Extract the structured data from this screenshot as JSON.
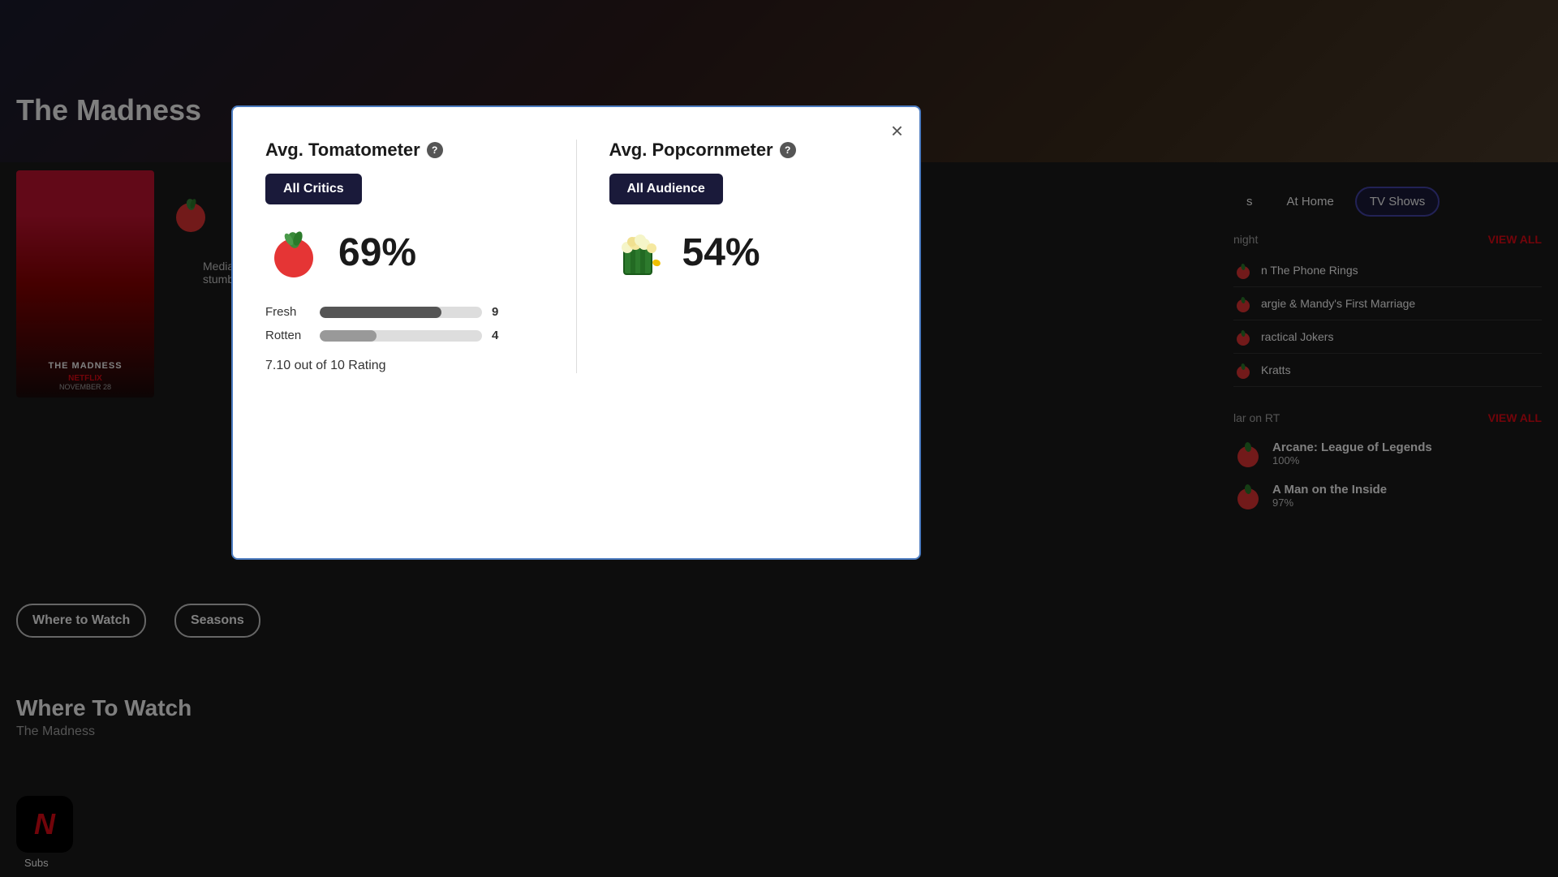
{
  "page": {
    "title": "The Madness"
  },
  "background": {
    "hero_gradient": "dark thriller background"
  },
  "left_panel": {
    "page_title": "The Madness",
    "poster": {
      "title_text": "THE MADNESS",
      "platform": "NETFLIX",
      "release": "NOVEMBER 28"
    },
    "description": "Media... stumb...",
    "where_to_watch_btn": "Where to Watch",
    "seasons_btn": "Seasons",
    "where_to_watch_section": {
      "title": "Where To Watch",
      "subtitle": "The Madness"
    },
    "netflix_app": {
      "label": "Subs"
    }
  },
  "right_panel": {
    "nav_tabs": [
      {
        "label": "s",
        "active": false
      },
      {
        "label": "At Home",
        "active": false
      },
      {
        "label": "TV Shows",
        "active": true
      }
    ],
    "tonight_section": {
      "label": "night",
      "view_all": "VIEW ALL",
      "shows": [
        {
          "title": "n The Phone Rings",
          "score": ""
        },
        {
          "title": "argie & Mandy's First Marriage",
          "score": ""
        },
        {
          "title": "ractical Jokers",
          "score": ""
        },
        {
          "title": "Kratts",
          "score": ""
        }
      ]
    },
    "popular_section": {
      "label": "lar on RT",
      "view_all": "VIEW ALL",
      "shows": [
        {
          "title": "Arcane: League of Legends",
          "score": "100%"
        },
        {
          "title": "A Man on the Inside",
          "score": "97%"
        }
      ]
    }
  },
  "modal": {
    "tomatometer_title": "Avg. Tomatometer",
    "popcornmeter_title": "Avg. Popcornmeter",
    "critics_btn": "All Critics",
    "audience_btn": "All Audience",
    "tomatometer_score": "69%",
    "popcornmeter_score": "54%",
    "fresh_label": "Fresh",
    "fresh_count": 9,
    "fresh_bar_pct": 69,
    "rotten_label": "Rotten",
    "rotten_count": 4,
    "rotten_bar_pct": 31,
    "rating_text": "7.10 out of 10 Rating",
    "close_btn": "×"
  }
}
